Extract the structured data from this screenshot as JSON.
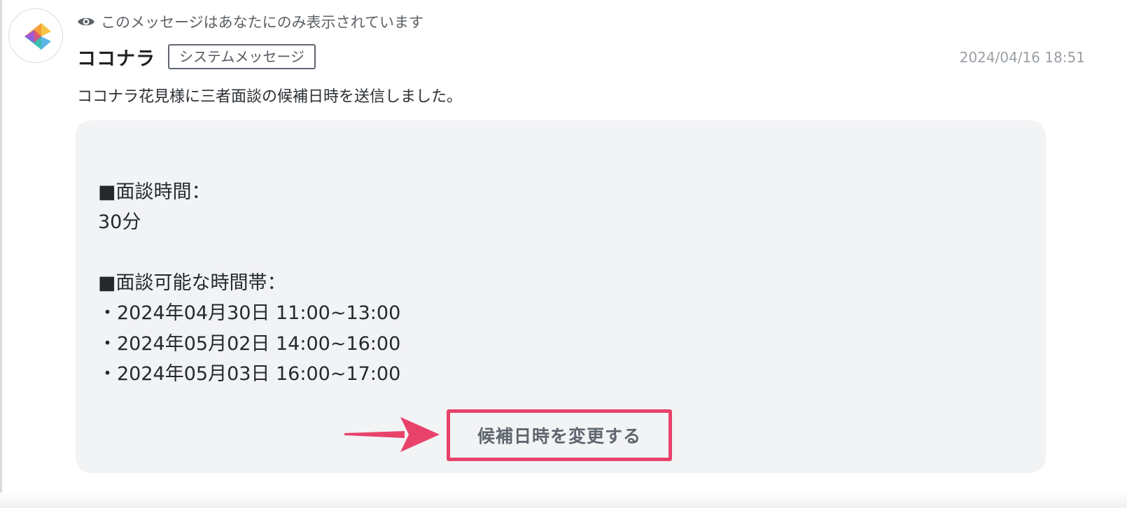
{
  "visibility_note": "このメッセージはあなたにのみ表示されています",
  "sender": {
    "name": "ココナラ",
    "badge": "システムメッセージ",
    "timestamp": "2024/04/16 18:51"
  },
  "message": "ココナラ花見様に三者面談の候補日時を送信しました。",
  "card": {
    "duration_heading": "■面談時間：",
    "duration_value": "30分",
    "slots_heading": "■面談可能な時間帯：",
    "slots": [
      "・2024年04月30日 11:00~13:00",
      "・2024年05月02日 14:00~16:00",
      "・2024年05月03日 16:00~17:00"
    ],
    "button_label": "候補日時を変更する"
  },
  "colors": {
    "highlight": "#e8426b",
    "card_background": "#f2f3f5"
  },
  "icons": {
    "visibility": "eye-icon",
    "avatar": "coconala-logo"
  }
}
